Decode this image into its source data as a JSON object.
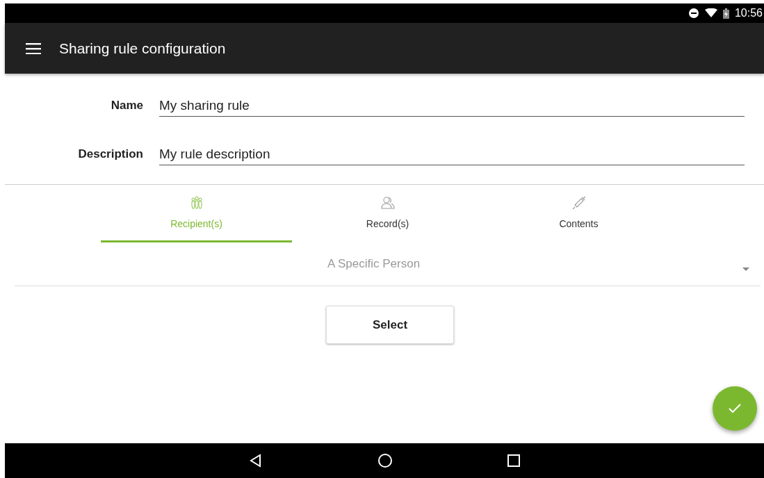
{
  "status_bar": {
    "time": "10:56"
  },
  "app_bar": {
    "title": "Sharing rule configuration"
  },
  "fields": [
    {
      "label": "Name",
      "value": "My sharing rule"
    },
    {
      "label": "Description",
      "value": "My rule description"
    }
  ],
  "tabs": [
    {
      "kind": "people",
      "label": "Recipient(s)",
      "selected": true
    },
    {
      "kind": "person",
      "label": "Record(s)",
      "selected": false
    },
    {
      "kind": "syringe",
      "label": "Contents",
      "selected": false
    }
  ],
  "dropdown": {
    "value": "A Specific Person"
  },
  "select_button": "Select"
}
